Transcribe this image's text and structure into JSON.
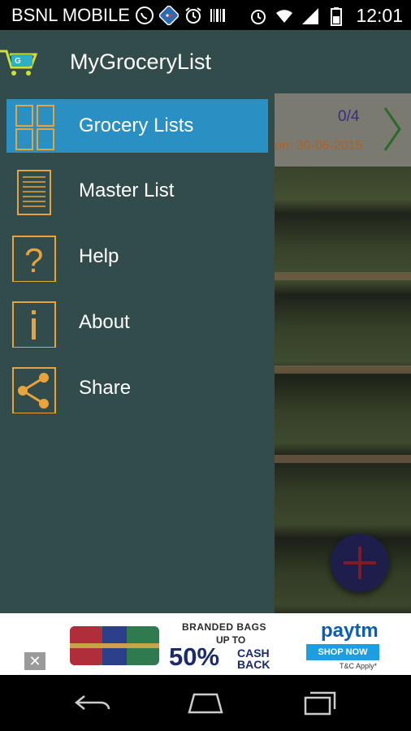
{
  "status_bar": {
    "carrier": "BSNL MOBILE",
    "time": "12:01",
    "icons": [
      "whatsapp-icon",
      "dominos-icon",
      "alarm-icon",
      "barcode-icon",
      "alarm-icon",
      "wifi-icon",
      "signal-icon",
      "battery-icon"
    ]
  },
  "app_bar": {
    "title": "MyGroceryList",
    "logo_icon": "cart-logo-icon"
  },
  "drawer": {
    "items": [
      {
        "label": "Grocery Lists",
        "icon": "grocery-lists-icon",
        "active": true
      },
      {
        "label": "Master List",
        "icon": "master-list-icon",
        "active": false
      },
      {
        "label": "Help",
        "icon": "help-icon",
        "active": false
      },
      {
        "label": "About",
        "icon": "info-icon",
        "active": false
      },
      {
        "label": "Share",
        "icon": "share-icon",
        "active": false
      }
    ]
  },
  "background_list": {
    "count": "0/4",
    "date_fragment": "on: 30-06-2015"
  },
  "ad": {
    "close_label": "✕",
    "headline": "BRANDED BAGS",
    "upto": "UP TO",
    "percent": "50%",
    "cashback": "CASH\nBACK",
    "brand": "paytm",
    "cta": "SHOP NOW",
    "terms": "T&C Apply*"
  },
  "colors": {
    "drawer_bg": "#324c4c",
    "active_item": "#2a8fc2",
    "icon_orange": "#e8a33c"
  }
}
